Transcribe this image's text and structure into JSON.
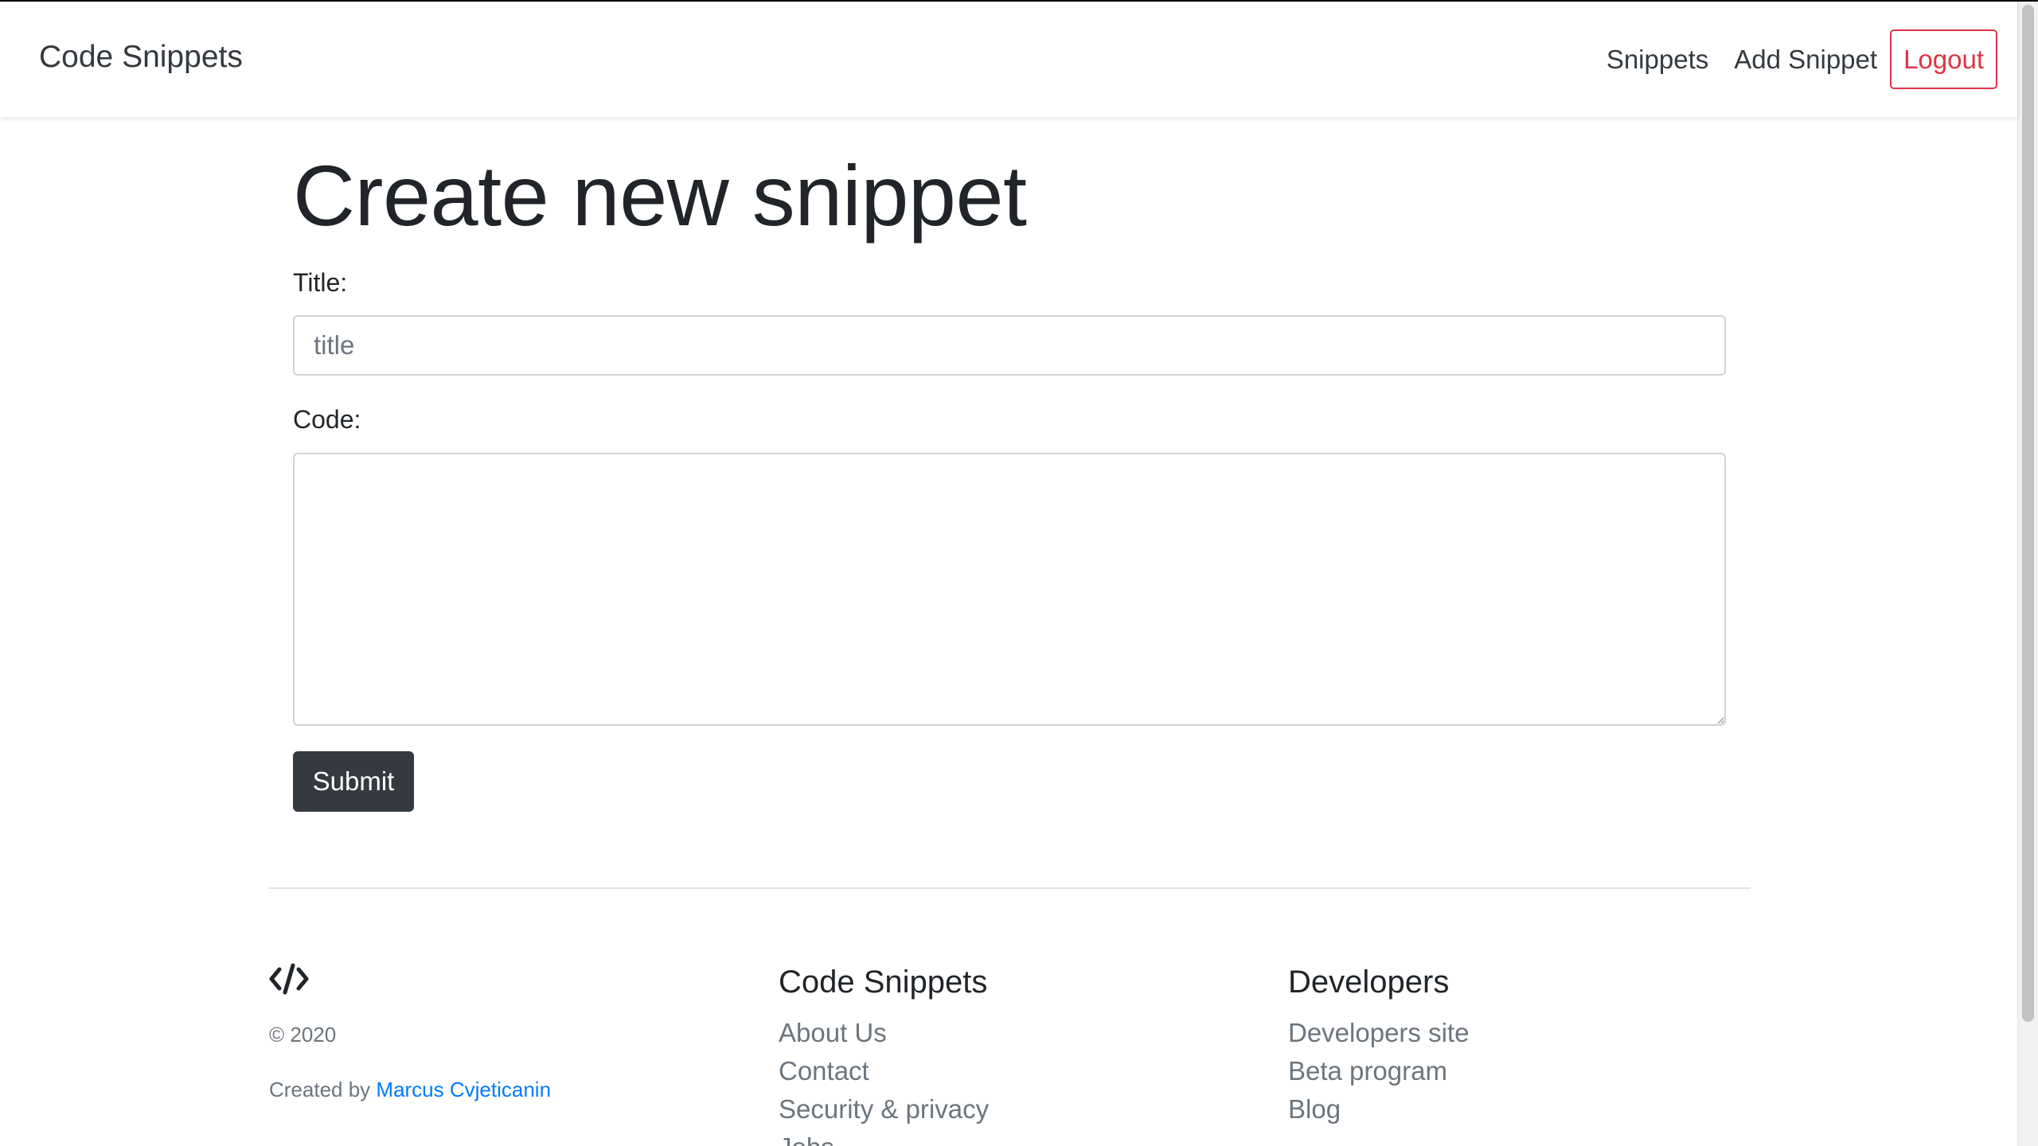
{
  "navbar": {
    "brand": "Code Snippets",
    "links": [
      {
        "label": "Snippets"
      },
      {
        "label": "Add Snippet"
      }
    ],
    "logout_label": "Logout"
  },
  "form": {
    "heading": "Create new snippet",
    "title_label": "Title:",
    "title_value": "",
    "title_placeholder": "title",
    "code_label": "Code:",
    "code_value": "",
    "submit_label": "Submit"
  },
  "footer": {
    "icon": "code-brackets-icon",
    "copyright": "© 2020",
    "created_by_prefix": "Created by ",
    "author": "Marcus Cvjeticanin",
    "columns": [
      {
        "heading": "Code Snippets",
        "links": [
          "About Us",
          "Contact",
          "Security & privacy",
          "Jobs"
        ]
      },
      {
        "heading": "Developers",
        "links": [
          "Developers site",
          "Beta program",
          "Blog"
        ]
      }
    ]
  },
  "colors": {
    "danger": "#dc3545",
    "dark": "#343a40",
    "link": "#007bff",
    "muted": "#6c757d",
    "border": "#ced4da"
  }
}
